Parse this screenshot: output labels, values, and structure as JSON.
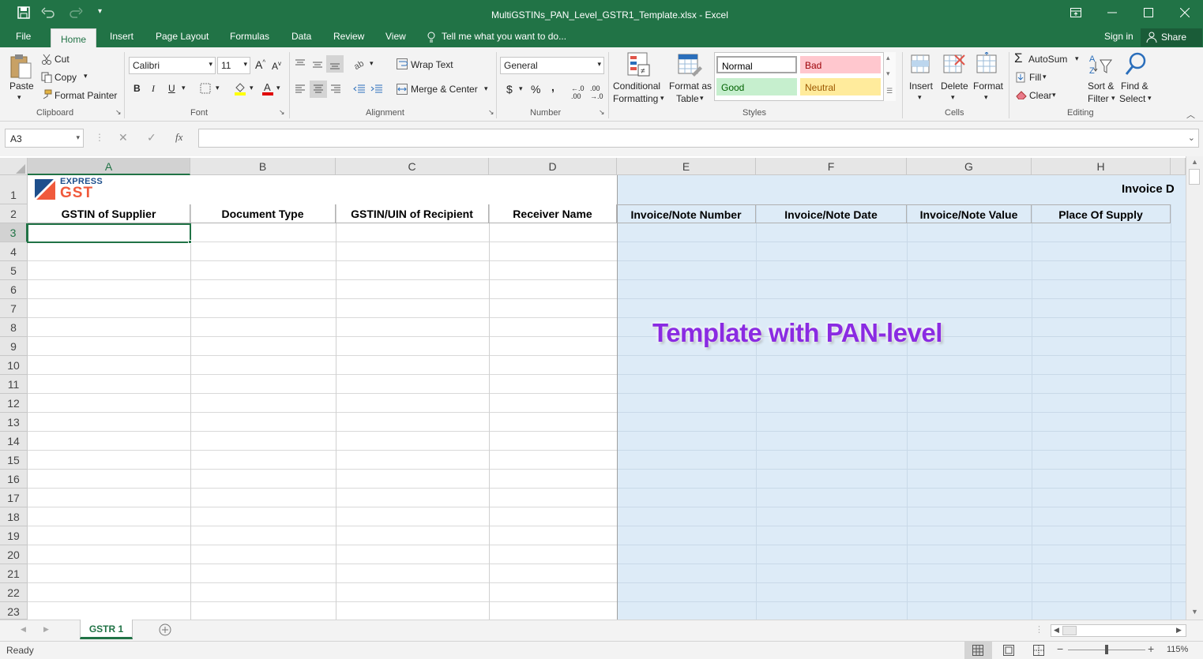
{
  "window": {
    "title": "MultiGSTINs_PAN_Level_GSTR1_Template.xlsx - Excel",
    "sign_in": "Sign in",
    "share": "Share"
  },
  "tabs": [
    "File",
    "Home",
    "Insert",
    "Page Layout",
    "Formulas",
    "Data",
    "Review",
    "View"
  ],
  "tell_me": "Tell me what you want to do...",
  "ribbon": {
    "clipboard": {
      "paste": "Paste",
      "cut": "Cut",
      "copy": "Copy",
      "format_painter": "Format Painter",
      "group": "Clipboard"
    },
    "font": {
      "name": "Calibri",
      "size": "11",
      "bold": "B",
      "italic": "I",
      "underline": "U",
      "group": "Font"
    },
    "alignment": {
      "wrap_text": "Wrap Text",
      "merge_center": "Merge & Center",
      "group": "Alignment"
    },
    "number": {
      "format": "General",
      "currency": "$",
      "percent": "%",
      "comma": ",",
      "group": "Number"
    },
    "styles": {
      "conditional1": "Conditional",
      "conditional2": "Formatting",
      "format_table1": "Format as",
      "format_table2": "Table",
      "normal": "Normal",
      "bad": "Bad",
      "good": "Good",
      "neutral": "Neutral",
      "group": "Styles"
    },
    "cells": {
      "insert": "Insert",
      "delete": "Delete",
      "format": "Format",
      "group": "Cells"
    },
    "editing": {
      "autosum": "AutoSum",
      "fill": "Fill",
      "clear": "Clear",
      "sort1": "Sort &",
      "sort2": "Filter",
      "find1": "Find &",
      "find2": "Select",
      "group": "Editing"
    }
  },
  "formula_bar": {
    "name_box": "A3",
    "fx": "fx",
    "value": ""
  },
  "columns": [
    "A",
    "B",
    "C",
    "D",
    "E",
    "F",
    "G",
    "H"
  ],
  "rows": [
    "1",
    "2",
    "3",
    "4",
    "5",
    "6",
    "7",
    "8",
    "9",
    "10",
    "11",
    "12",
    "13",
    "14",
    "15",
    "16",
    "17",
    "18",
    "19",
    "20",
    "21",
    "22",
    "23"
  ],
  "sheet": {
    "logo_top": "EXPRESS",
    "logo_bottom": "GST",
    "section_header": "Invoice D",
    "headers": [
      "GSTIN of Supplier",
      "Document Type",
      "GSTIN/UIN of Recipient",
      "Receiver Name",
      "Invoice/Note Number",
      "Invoice/Note Date",
      "Invoice/Note Value",
      "Place Of Supply"
    ],
    "overlay": "Template with PAN-level"
  },
  "sheet_tab": "GSTR 1",
  "status": {
    "ready": "Ready",
    "zoom": "115%"
  },
  "colors": {
    "excel_green": "#217346",
    "blue_fill": "#ddebf7",
    "overlay_purple": "#8a2be2"
  }
}
